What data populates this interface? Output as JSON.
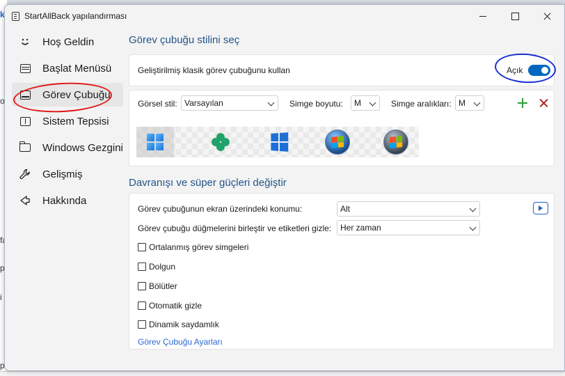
{
  "window": {
    "title": "StartAllBack yapılandırması"
  },
  "background_fragments": [
    "k",
    "o",
    "fa",
    "p",
    "i",
    "p"
  ],
  "sidebar": {
    "items": [
      {
        "label": "Hoş Geldin",
        "icon": "smiley-icon"
      },
      {
        "label": "Başlat Menüsü",
        "icon": "start-menu-icon"
      },
      {
        "label": "Görev Çubuğu",
        "icon": "taskbar-icon",
        "active": true
      },
      {
        "label": "Sistem Tepsisi",
        "icon": "system-tray-icon"
      },
      {
        "label": "Windows Gezgini",
        "icon": "folder-icon"
      },
      {
        "label": "Gelişmiş",
        "icon": "wrench-icon"
      },
      {
        "label": "Hakkında",
        "icon": "info-icon"
      }
    ]
  },
  "style_section": {
    "title": "Görev çubuğu stilini seç",
    "classic_label": "Geliştirilmiş klasik görev çubuğunu kullan",
    "toggle_label": "Açık",
    "toggle_on": true,
    "visual_style_label": "Görsel stil:",
    "visual_style_value": "Varsayılan",
    "icon_size_label": "Simge boyutu:",
    "icon_size_value": "M",
    "icon_spacing_label": "Simge aralıkları:",
    "icon_spacing_value": "M",
    "preview_icons": [
      "windows-11-logo-icon",
      "clover-icon",
      "windows-10-logo-icon",
      "windows-7-orb-icon",
      "windows-vista-orb-icon"
    ]
  },
  "behavior_section": {
    "title": "Davranışı ve süper güçleri değiştir",
    "position_label": "Görev çubuğunun ekran üzerindeki konumu:",
    "position_value": "Alt",
    "combine_label": "Görev çubuğu düğmelerini birleştir ve etiketleri gizle:",
    "combine_value": "Her zaman",
    "checkboxes": [
      {
        "label": "Ortalanmış görev simgeleri",
        "checked": false
      },
      {
        "label": "Dolgun",
        "checked": false
      },
      {
        "label": "Bölütler",
        "checked": false
      },
      {
        "label": "Otomatik gizle",
        "checked": false
      },
      {
        "label": "Dinamik saydamlık",
        "checked": false
      }
    ],
    "settings_link": "Görev Çubuğu Ayarları"
  },
  "colors": {
    "accent": "#0067c0",
    "section_title": "#22558a",
    "link": "#2a6ad3",
    "annotation_red": "#e01818",
    "annotation_blue": "#1a2ed0"
  }
}
